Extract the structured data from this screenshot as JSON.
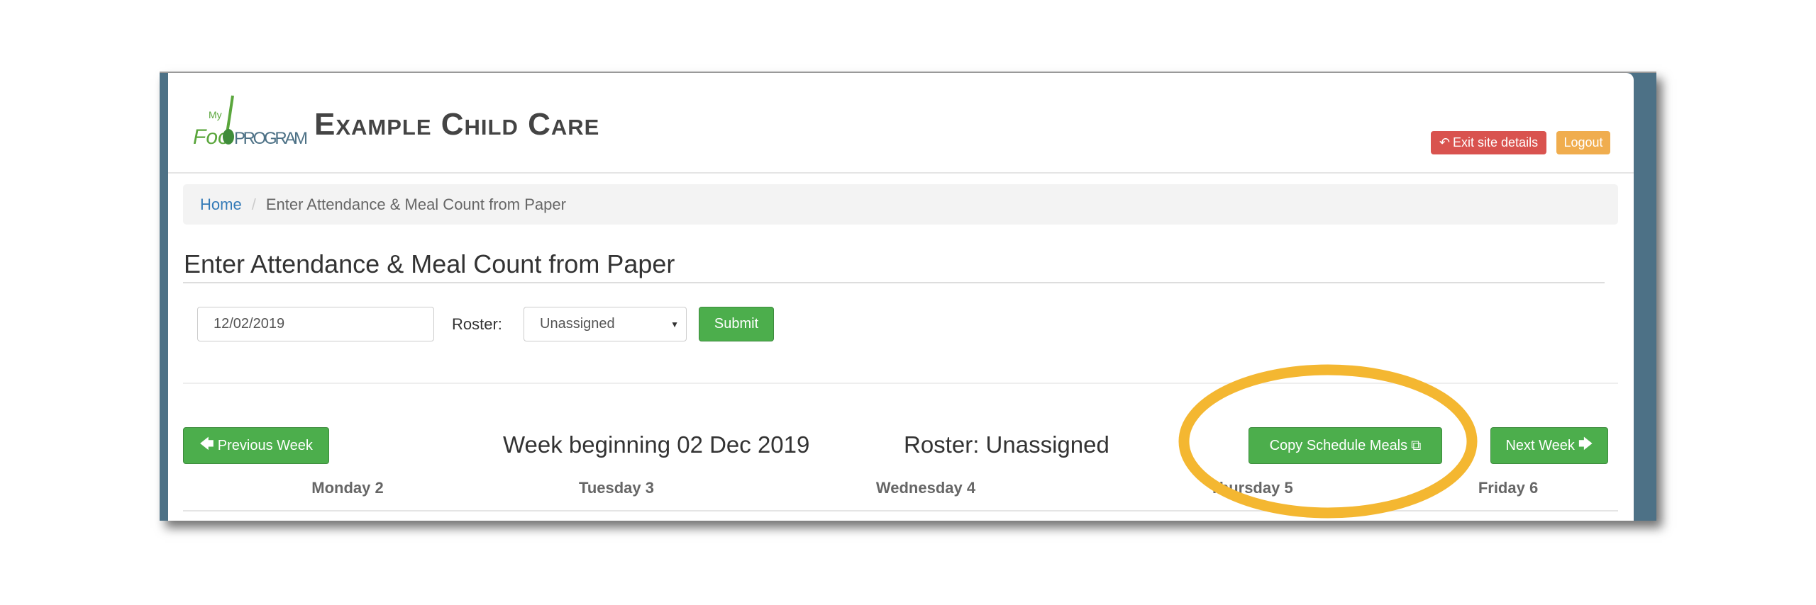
{
  "header": {
    "logo_text": "My Food PROGRAM",
    "site_title": "Example Child Care",
    "exit_label": "Exit site details",
    "logout_label": "Logout"
  },
  "breadcrumb": {
    "home": "Home",
    "separator": "/",
    "current": "Enter Attendance & Meal Count from Paper"
  },
  "page_title": "Enter Attendance & Meal Count from Paper",
  "form": {
    "date_value": "12/02/2019",
    "roster_label": "Roster:",
    "roster_value": "Unassigned",
    "submit_label": "Submit"
  },
  "week": {
    "prev_label": "Previous Week",
    "title": "Week beginning 02 Dec 2019",
    "roster": "Roster: Unassigned",
    "copy_label": "Copy Schedule Meals",
    "next_label": "Next Week",
    "days": [
      "Monday 2",
      "Tuesday 3",
      "Wednesday 4",
      "Thursday 5",
      "Friday 6"
    ]
  },
  "colors": {
    "highlight": "#f4b731",
    "success": "#4cae4c",
    "danger": "#d9534f",
    "warning": "#f0ad4e",
    "frame": "#4d7186"
  }
}
